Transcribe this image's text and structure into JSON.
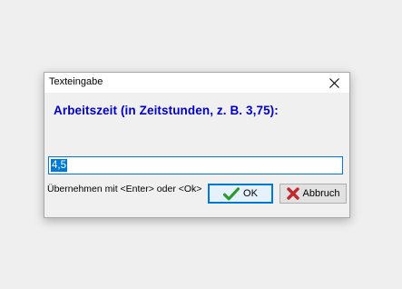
{
  "dialog": {
    "title": "Texteingabe",
    "prompt": "Arbeitszeit (in Zeitstunden, z. B. 3,75):",
    "input_value": "4,5",
    "hint": "Übernehmen mit <Enter> oder <Ok>",
    "ok_label": "OK",
    "cancel_label": "Abbruch"
  },
  "icons": {
    "close": "close-icon",
    "ok": "checkmark-icon",
    "cancel": "red-x-icon"
  },
  "colors": {
    "prompt_text": "#0000c8",
    "focus_border": "#0078d7",
    "selection": "#0078d7",
    "ok_check": "#2e9a2e",
    "cancel_x": "#c0282d"
  }
}
